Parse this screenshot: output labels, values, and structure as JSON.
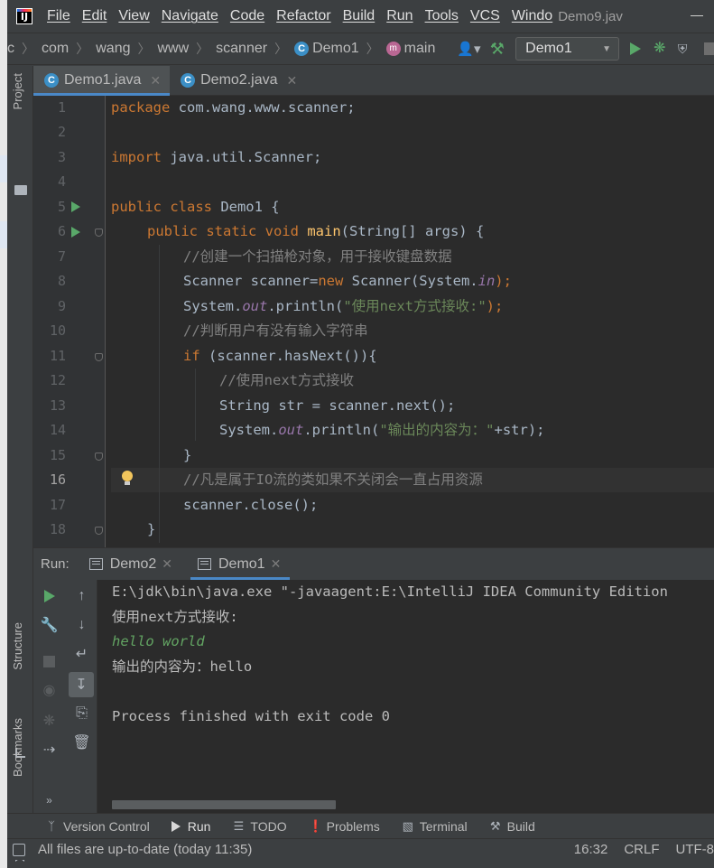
{
  "menubar": {
    "items": [
      "File",
      "Edit",
      "View",
      "Navigate",
      "Code",
      "Refactor",
      "Build",
      "Run",
      "Tools",
      "VCS",
      "Windo"
    ],
    "window_title": "Demo9.jav"
  },
  "navbar": {
    "crumbs": [
      "c",
      "com",
      "wang",
      "www",
      "scanner",
      "Demo1",
      "main"
    ],
    "run_config": "Demo1"
  },
  "left_strip": {
    "project": "Project",
    "structure": "Structure",
    "bookmarks": "Bookmarks"
  },
  "tabs": [
    {
      "label": "Demo1.java",
      "active": true
    },
    {
      "label": "Demo2.java",
      "active": false
    }
  ],
  "editor": {
    "current_line": 16,
    "line_numbers": [
      "1",
      "2",
      "3",
      "4",
      "5",
      "6",
      "7",
      "8",
      "9",
      "10",
      "11",
      "12",
      "13",
      "14",
      "15",
      "16",
      "17",
      "18"
    ],
    "code": {
      "l1_kw": "package",
      "l1_rest": " com.wang.www.scanner;",
      "l3_kw": "import",
      "l3_rest": " java.util.Scanner;",
      "l5_kw": "public class",
      "l5_rest": " Demo1 {",
      "l6_kw": "public static void",
      "l6_fn": "main",
      "l6_rest": "(String[] args) {",
      "l7_cm": "//创建一个扫描枪对象，用于接收键盘数据",
      "l8_a": "Scanner scanner=",
      "l8_kw": "new",
      "l8_b": " Scanner(System.",
      "l8_it": "in",
      "l8_c": ");",
      "l9_a": "System.",
      "l9_it": "out",
      "l9_b": ".println(",
      "l9_st": "\"使用next方式接收:\"",
      "l9_c": ");",
      "l10_cm": "//判断用户有没有输入字符串",
      "l11_kw": "if",
      "l11_rest": " (scanner.hasNext()){",
      "l12_cm": "//使用next方式接收",
      "l13_a": "String str = scanner.next();",
      "l14_a": "System.",
      "l14_it": "out",
      "l14_b": ".println(",
      "l14_st": "\"输出的内容为：\"",
      "l14_c": "+str);",
      "l15_a": "}",
      "l16_cm": "//凡是属于IO流的类如果不关闭会一直占用资源",
      "l17_a": "scanner.close();",
      "l18_a": "}"
    }
  },
  "run_panel": {
    "title": "Run:",
    "tabs": [
      {
        "label": "Demo2",
        "active": false
      },
      {
        "label": "Demo1",
        "active": true
      }
    ],
    "console_lines": [
      "E:\\jdk\\bin\\java.exe \"-javaagent:E:\\IntelliJ IDEA Community Edition",
      "使用next方式接收:",
      "hello world",
      "输出的内容为：hello",
      "",
      "Process finished with exit code 0"
    ]
  },
  "bottom_tabs": [
    "Version Control",
    "Run",
    "TODO",
    "Problems",
    "Terminal",
    "Build"
  ],
  "statusbar": {
    "message": "All files are up-to-date (today 11:35)",
    "position": "16:32",
    "line_sep": "CRLF",
    "encoding": "UTF-8"
  }
}
